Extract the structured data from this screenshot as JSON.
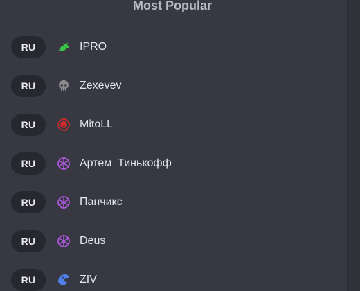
{
  "header": {
    "title": "Most Popular"
  },
  "players": [
    {
      "region": "RU",
      "name": "IPRO",
      "icon": "dragon-icon",
      "icon_color": "#3cc24a"
    },
    {
      "region": "RU",
      "name": "Zexevev",
      "icon": "skull-icon",
      "icon_color": "#8a8a8a"
    },
    {
      "region": "RU",
      "name": "MitoLL",
      "icon": "demon-mask-icon",
      "icon_color": "#d42a2a"
    },
    {
      "region": "RU",
      "name": "Артем_Тинькофф",
      "icon": "rune-wheel-icon",
      "icon_color": "#a858d6"
    },
    {
      "region": "RU",
      "name": "Панчикс",
      "icon": "rune-wheel-icon",
      "icon_color": "#a858d6"
    },
    {
      "region": "RU",
      "name": "Deus",
      "icon": "rune-wheel-icon",
      "icon_color": "#a858d6"
    },
    {
      "region": "RU",
      "name": "ZIV",
      "icon": "eagle-icon",
      "icon_color": "#4f7fe6"
    }
  ]
}
